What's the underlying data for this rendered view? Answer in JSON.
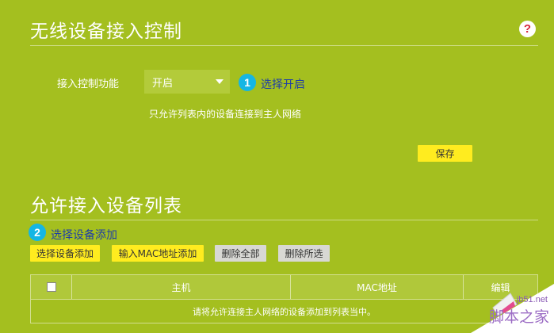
{
  "access_control": {
    "title": "无线设备接入控制",
    "help_icon": "?",
    "function_label": "接入控制功能",
    "select_value": "开启",
    "step1_number": "1",
    "step1_text": "选择开启",
    "hint": "只允许列表内的设备连接到主人网络",
    "save_label": "保存"
  },
  "allow_list": {
    "title": "允许接入设备列表",
    "step2_number": "2",
    "step2_text": "选择设备添加",
    "buttons": {
      "select_device": "选择设备添加",
      "input_mac": "输入MAC地址添加",
      "delete_all": "删除全部",
      "delete_selected": "删除所选"
    },
    "table": {
      "columns": [
        "主机",
        "MAC地址",
        "编辑"
      ],
      "empty_message": "请将允许连接主人网络的设备添加到列表当中。"
    }
  },
  "watermark": {
    "domain": "jb51.net",
    "site": "脚本之家"
  },
  "colors": {
    "background": "#a4bf1f",
    "accent_yellow": "#ffec1f",
    "step_badge": "#15b6e4",
    "step_text": "#1f3ea6",
    "help_icon": "#d7263d"
  }
}
